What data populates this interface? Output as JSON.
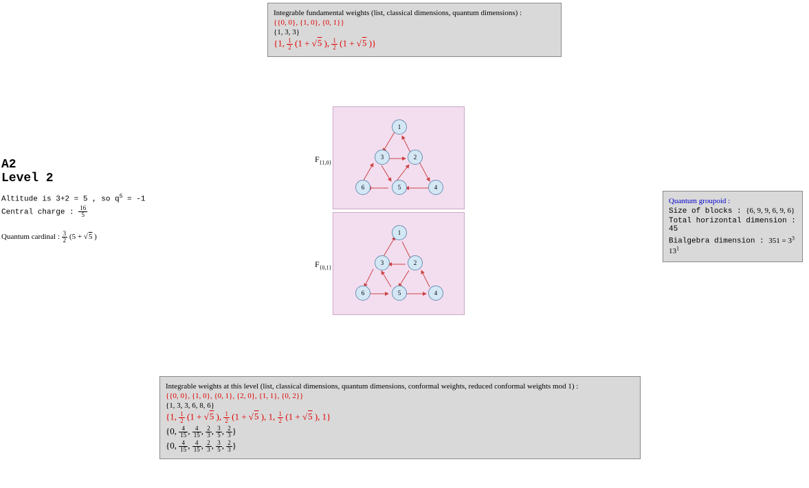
{
  "top_box": {
    "header": "Integrable fundamental weights (list, classical dimensions, quantum dimensions) :",
    "weights_list": "{{0, 0}, {1, 0}, {0, 1}}",
    "classical_dims": "{1, 3, 3}"
  },
  "left": {
    "title1": "A2",
    "title2": "Level 2",
    "altitude_label": "Altitude is 3+2 = 5 , so q",
    "altitude_exp": "5",
    "altitude_rhs": " = -1",
    "central_charge_label": "Central charge : ",
    "central_charge_num": "16",
    "central_charge_den": "5",
    "qcard_label": "Quantum cardinal : ",
    "qcard_num": "3",
    "qcard_den": "2",
    "qcard_inner": "5",
    "qcard_sqrt": "5"
  },
  "graph_labels": {
    "f10": "F",
    "f10_sub": "{1,0}",
    "f01": "F",
    "f01_sub": "{0,1}"
  },
  "nodes": {
    "n1": "1",
    "n2": "2",
    "n3": "3",
    "n4": "4",
    "n5": "5",
    "n6": "6"
  },
  "right_box": {
    "header": "Quantum groupoid :",
    "blocks_label": "Size of blocks : ",
    "blocks": "{6, 9, 9, 6, 9, 6}",
    "thd_label": "Total horizontal dimension : ",
    "thd": "45",
    "bialg_label": "Bialgebra dimension : ",
    "bialg": "351 = 3",
    "bialg_e1": "3",
    "bialg_mid": " 13",
    "bialg_e2": "1"
  },
  "bottom_box": {
    "header": "Integrable weights at this level (list, classical dimensions, quantum dimensions, conformal weights, reduced conformal weights mod 1) :",
    "weights_list": "{{0, 0}, {1, 0}, {0, 1}, {2, 0}, {1, 1}, {0, 2}}",
    "classical_dims": "{1, 3, 3, 6, 8, 6}",
    "conformal_a": "0",
    "conformal_b_num": "4",
    "conformal_b_den": "15",
    "conformal_c_num": "4",
    "conformal_c_den": "15",
    "conformal_d_num": "2",
    "conformal_d_den": "3",
    "conformal_e_num": "3",
    "conformal_e_den": "5",
    "conformal_f_num": "2",
    "conformal_f_den": "3"
  }
}
